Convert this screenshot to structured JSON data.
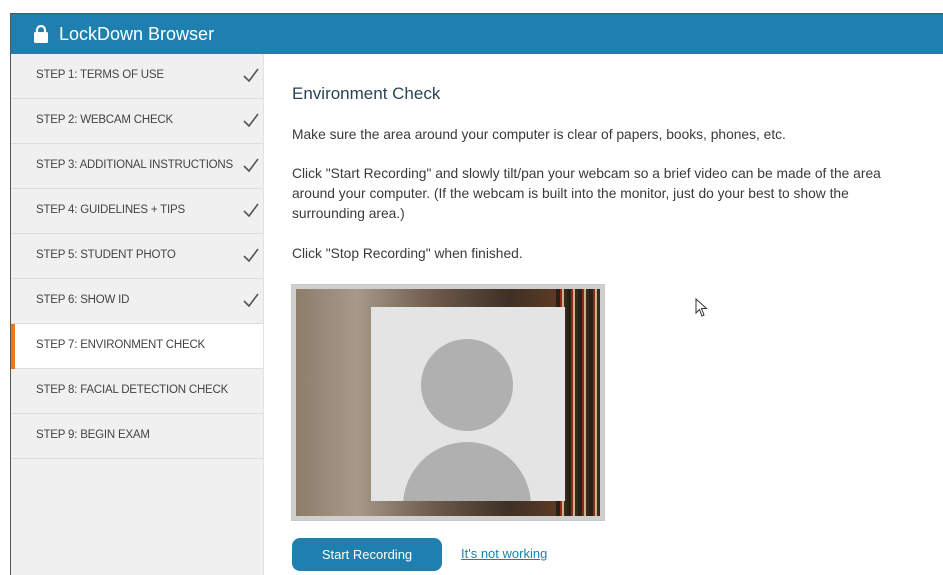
{
  "window": {
    "title": "LockDown Browser"
  },
  "sidebar": {
    "steps": [
      {
        "label": "STEP 1: TERMS OF USE",
        "done": true
      },
      {
        "label": "STEP 2: WEBCAM CHECK",
        "done": true
      },
      {
        "label": "STEP 3: ADDITIONAL INSTRUCTIONS",
        "done": true
      },
      {
        "label": "STEP 4: GUIDELINES + TIPS",
        "done": true
      },
      {
        "label": "STEP 5: STUDENT PHOTO",
        "done": true
      },
      {
        "label": "STEP 6: SHOW ID",
        "done": true
      },
      {
        "label": "STEP 7: ENVIRONMENT CHECK",
        "done": false,
        "active": true
      },
      {
        "label": "STEP 8: FACIAL DETECTION CHECK",
        "done": false
      },
      {
        "label": "STEP 9: BEGIN EXAM",
        "done": false
      }
    ]
  },
  "main": {
    "heading": "Environment Check",
    "para1": "Make sure the area around your computer is clear of papers, books, phones, etc.",
    "para2": "Click \"Start Recording\" and slowly tilt/pan your webcam so a brief video can be made of the area around your computer. (If the webcam is built into the monitor, just do your best to show the surrounding area.)",
    "para3": "Click \"Stop Recording\" when finished.",
    "start_button": "Start Recording",
    "help_link": "It's not working"
  },
  "colors": {
    "accent": "#1f7fae",
    "active_marker": "#e8791e",
    "sidebar_bg": "#f0f0f0"
  },
  "icons": {
    "title": "lock-icon",
    "step_done": "checkmark-icon",
    "pointer": "mouse-cursor-icon"
  }
}
